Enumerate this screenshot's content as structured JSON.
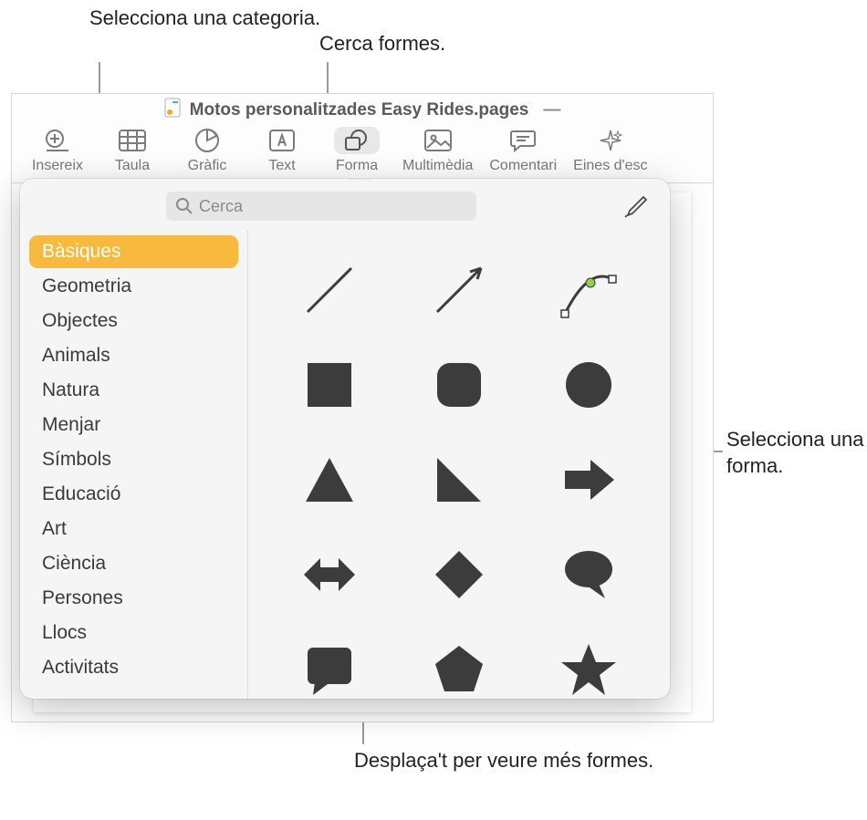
{
  "callouts": {
    "select_category": "Selecciona una categoria.",
    "search_shapes": "Cerca formes.",
    "select_shape": "Selecciona una forma.",
    "scroll_more": "Desplaça't per veure més formes."
  },
  "titlebar": {
    "doc_name": "Motos personalitzades Easy Rides.pages",
    "dash": "—"
  },
  "toolbar": {
    "insert": "Insereix",
    "table": "Taula",
    "chart": "Gràfic",
    "text": "Text",
    "shape": "Forma",
    "media": "Multimèdia",
    "comment": "Comentari",
    "writing_tools": "Eines d'esc"
  },
  "popover": {
    "search_placeholder": "Cerca",
    "categories": [
      "Bàsiques",
      "Geometria",
      "Objectes",
      "Animals",
      "Natura",
      "Menjar",
      "Símbols",
      "Educació",
      "Art",
      "Ciència",
      "Persones",
      "Llocs",
      "Activitats"
    ],
    "shapes": [
      "line",
      "arrow-line",
      "curve",
      "square",
      "rounded-square",
      "circle",
      "triangle",
      "right-triangle",
      "arrow-right",
      "double-arrow",
      "diamond",
      "speech-bubble",
      "callout-rect",
      "pentagon",
      "star"
    ]
  }
}
